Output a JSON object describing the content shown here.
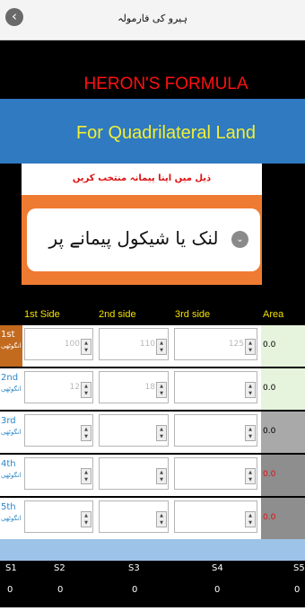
{
  "header": {
    "back_icon": "chevron-left-icon",
    "title": "ہیرو کی فارمولہ"
  },
  "banner": {
    "heron_title": "HERON'S FORMULA",
    "subtitle": "For Quadrilateral Land"
  },
  "unit_picker": {
    "hint": "ذیل میں اپنا پیمانہ منتخب کریں",
    "selected": "لنک یا شیکول پیمانے پر"
  },
  "table": {
    "headers": [
      "1st Side",
      "2nd side",
      "3rd side",
      "Area"
    ],
    "rows": [
      {
        "label": "1st",
        "sub": "انگوٹھی",
        "s1": "100",
        "s2": "110",
        "s3": "125",
        "area": "0.0",
        "area_color": "#000000",
        "area_bg": "#e6f3dd"
      },
      {
        "label": "2nd",
        "sub": "انگوٹھی",
        "s1": "12",
        "s2": "18",
        "s3": "",
        "area": "0.0",
        "area_color": "#000000",
        "area_bg": "#e6f3dd"
      },
      {
        "label": "3rd",
        "sub": "انگوٹھی",
        "s1": "",
        "s2": "",
        "s3": "",
        "area": "0.0",
        "area_color": "#000000",
        "area_bg": "#a9a9a9"
      },
      {
        "label": "4th",
        "sub": "انگوٹھی",
        "s1": "",
        "s2": "",
        "s3": "",
        "area": "0.0",
        "area_color": "#e01010",
        "area_bg": "#8e8e8e"
      },
      {
        "label": "5th",
        "sub": "انگوٹھی",
        "s1": "",
        "s2": "",
        "s3": "",
        "area": "0.0",
        "area_color": "#e01010",
        "area_bg": "#8e8e8e"
      }
    ]
  },
  "totals": {
    "labels": [
      "S1",
      "S2",
      "S3",
      "S4",
      "S5"
    ],
    "values": [
      "0",
      "0",
      "0",
      "0",
      "0"
    ]
  },
  "colors": {
    "accent_blue": "#2f7ac0",
    "orange": "#ef7b32",
    "header_yellow": "#f4e200"
  }
}
